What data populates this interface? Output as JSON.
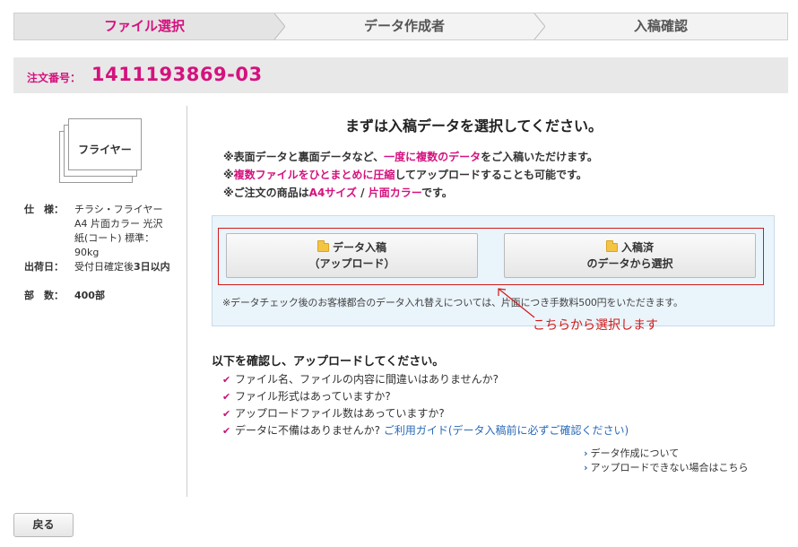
{
  "steps": [
    {
      "label": "ファイル選択",
      "active": true
    },
    {
      "label": "データ作成者",
      "active": false
    },
    {
      "label": "入稿確認",
      "active": false
    }
  ],
  "order": {
    "label": "注文番号：",
    "number": "1411193869-03"
  },
  "product": {
    "name": "フライヤー",
    "specs": [
      {
        "key": "仕　様：",
        "value": "チラシ・フライヤー A4 片面カラー 光沢紙(コート) 標準：90kg"
      },
      {
        "key": "出荷日：",
        "value_prefix": "受付日確定後",
        "value_strong": "3日以内"
      },
      {
        "key": "部　数：",
        "value": "400部"
      }
    ]
  },
  "main": {
    "title": "まずは入稿データを選択してください。",
    "notes": [
      {
        "pre": "※表面データと裏面データなど、",
        "em": "一度に複数のデータ",
        "post": "をご入稿いただけます。"
      },
      {
        "pre": "※",
        "em": "複数ファイルをひとまとめに圧縮",
        "post": "してアップロードすることも可能です。"
      },
      {
        "pre": "※ご注文の商品は",
        "em": "A4サイズ",
        "mid": " / ",
        "em2": "片面カラー",
        "post": "です。"
      }
    ],
    "upload_button": {
      "line1": "データ入稿",
      "line2": "（アップロード）"
    },
    "existing_button": {
      "line1": "入稿済",
      "line2": "のデータから選択"
    },
    "box_note": "※データチェック後のお客様都合のデータ入れ替えについては、片面につき手数料500円をいただきます。",
    "annotation": "こちらから選択します",
    "check_title": "以下を確認し、アップロードしてください。",
    "checks": [
      "ファイル名、ファイルの内容に間違いはありませんか?",
      "ファイル形式はあっていますか?",
      "アップロードファイル数はあっていますか?",
      "データに不備はありませんか?"
    ],
    "guide_link": "ご利用ガイド(データ入稿前に必ずご確認ください)",
    "side_links": [
      "データ作成について",
      "アップロードできない場合はこちら"
    ]
  },
  "back_button": "戻る",
  "colors": {
    "accent": "#d4127e",
    "annotation": "#d21a1a",
    "link": "#2a6ab8",
    "box": "#eaf4fb"
  },
  "icons": {
    "check": "check-icon",
    "folder": "folder-icon",
    "caret": "chevron-right-icon"
  }
}
